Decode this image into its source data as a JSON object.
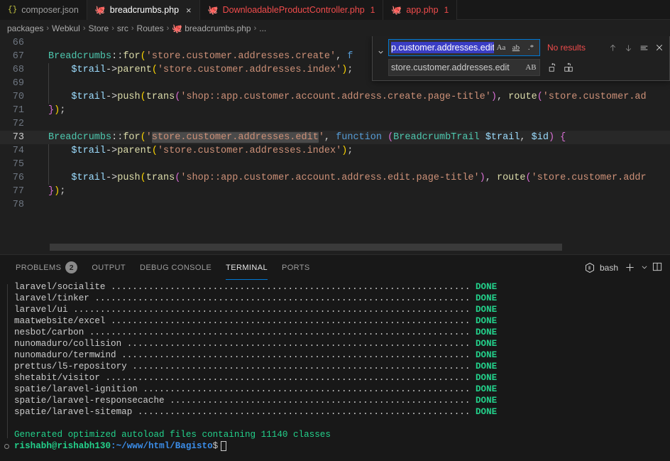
{
  "tabs": [
    {
      "label": "composer.json",
      "icon": "json-icon",
      "active": false,
      "dirty": false,
      "error_count": ""
    },
    {
      "label": "breadcrumbs.php",
      "icon": "php-icon",
      "active": true,
      "dirty": false,
      "error_count": "",
      "close": "×"
    },
    {
      "label": "DownloadableProductController.php",
      "icon": "php-icon",
      "active": false,
      "error_count": "1"
    },
    {
      "label": "app.php",
      "icon": "php-icon",
      "active": false,
      "error_count": "1"
    }
  ],
  "breadcrumb": {
    "items": [
      "packages",
      "Webkul",
      "Store",
      "src",
      "Routes",
      "breadcrumbs.php",
      "..."
    ],
    "separator": "›",
    "file_icon": "php-icon"
  },
  "editor": {
    "lines": [
      {
        "num": "66",
        "current": false,
        "indent_guide": false,
        "tokens": []
      },
      {
        "num": "67",
        "current": false,
        "indent_guide": false,
        "tokens": [
          {
            "t": "Breadcrumbs",
            "c": "t-class"
          },
          {
            "t": "::",
            "c": "t-punc"
          },
          {
            "t": "for",
            "c": "t-fn"
          },
          {
            "t": "(",
            "c": "t-paren"
          },
          {
            "t": "'store.customer.addresses.create'",
            "c": "t-str"
          },
          {
            "t": ",",
            "c": "t-punc"
          },
          {
            "t": " f",
            "c": "t-kw"
          }
        ]
      },
      {
        "num": "68",
        "current": false,
        "indent_guide": true,
        "tokens": [
          {
            "t": "    ",
            "c": "t-op"
          },
          {
            "t": "$trail",
            "c": "t-var"
          },
          {
            "t": "->",
            "c": "t-op"
          },
          {
            "t": "parent",
            "c": "t-fn"
          },
          {
            "t": "(",
            "c": "t-paren"
          },
          {
            "t": "'store.customer.addresses.index'",
            "c": "t-str"
          },
          {
            "t": ")",
            "c": "t-paren"
          },
          {
            "t": ";",
            "c": "t-punc"
          }
        ]
      },
      {
        "num": "69",
        "current": false,
        "indent_guide": true,
        "tokens": []
      },
      {
        "num": "70",
        "current": false,
        "indent_guide": true,
        "tokens": [
          {
            "t": "    ",
            "c": "t-op"
          },
          {
            "t": "$trail",
            "c": "t-var"
          },
          {
            "t": "->",
            "c": "t-op"
          },
          {
            "t": "push",
            "c": "t-fn"
          },
          {
            "t": "(",
            "c": "t-paren"
          },
          {
            "t": "trans",
            "c": "t-fn"
          },
          {
            "t": "(",
            "c": "t-paren2"
          },
          {
            "t": "'shop::app.customer.account.address.create.page-title'",
            "c": "t-str"
          },
          {
            "t": ")",
            "c": "t-paren2"
          },
          {
            "t": ",",
            "c": "t-punc"
          },
          {
            "t": " ",
            "c": "t-op"
          },
          {
            "t": "route",
            "c": "t-fn"
          },
          {
            "t": "(",
            "c": "t-paren2"
          },
          {
            "t": "'store.customer.ad",
            "c": "t-str"
          }
        ]
      },
      {
        "num": "71",
        "current": false,
        "indent_guide": false,
        "tokens": [
          {
            "t": "}",
            "c": "t-brace"
          },
          {
            "t": ")",
            "c": "t-paren"
          },
          {
            "t": ";",
            "c": "t-punc"
          }
        ]
      },
      {
        "num": "72",
        "current": false,
        "indent_guide": false,
        "tokens": []
      },
      {
        "num": "73",
        "current": true,
        "indent_guide": false,
        "tokens": [
          {
            "t": "Breadcrumbs",
            "c": "t-class"
          },
          {
            "t": "::",
            "c": "t-punc"
          },
          {
            "t": "for",
            "c": "t-fn"
          },
          {
            "t": "(",
            "c": "t-paren"
          },
          {
            "t": "'",
            "c": "t-str"
          },
          {
            "t": "store.customer.addresses.edit",
            "c": "t-str sel-hl"
          },
          {
            "t": "'",
            "c": "t-str"
          },
          {
            "t": ",",
            "c": "t-punc"
          },
          {
            "t": " ",
            "c": "t-op"
          },
          {
            "t": "function",
            "c": "t-kw"
          },
          {
            "t": " ",
            "c": "t-op"
          },
          {
            "t": "(",
            "c": "t-paren2"
          },
          {
            "t": "BreadcrumbTrail",
            "c": "t-class"
          },
          {
            "t": " ",
            "c": "t-op"
          },
          {
            "t": "$trail",
            "c": "t-var"
          },
          {
            "t": ",",
            "c": "t-punc"
          },
          {
            "t": " ",
            "c": "t-op"
          },
          {
            "t": "$id",
            "c": "t-var"
          },
          {
            "t": ")",
            "c": "t-paren2"
          },
          {
            "t": " ",
            "c": "t-op"
          },
          {
            "t": "{",
            "c": "t-brace"
          }
        ]
      },
      {
        "num": "74",
        "current": false,
        "indent_guide": true,
        "tokens": [
          {
            "t": "    ",
            "c": "t-op"
          },
          {
            "t": "$trail",
            "c": "t-var"
          },
          {
            "t": "->",
            "c": "t-op"
          },
          {
            "t": "parent",
            "c": "t-fn"
          },
          {
            "t": "(",
            "c": "t-paren"
          },
          {
            "t": "'store.customer.addresses.index'",
            "c": "t-str"
          },
          {
            "t": ")",
            "c": "t-paren"
          },
          {
            "t": ";",
            "c": "t-punc"
          }
        ]
      },
      {
        "num": "75",
        "current": false,
        "indent_guide": true,
        "tokens": []
      },
      {
        "num": "76",
        "current": false,
        "indent_guide": true,
        "tokens": [
          {
            "t": "    ",
            "c": "t-op"
          },
          {
            "t": "$trail",
            "c": "t-var"
          },
          {
            "t": "->",
            "c": "t-op"
          },
          {
            "t": "push",
            "c": "t-fn"
          },
          {
            "t": "(",
            "c": "t-paren"
          },
          {
            "t": "trans",
            "c": "t-fn"
          },
          {
            "t": "(",
            "c": "t-paren2"
          },
          {
            "t": "'shop::app.customer.account.address.edit.page-title'",
            "c": "t-str"
          },
          {
            "t": ")",
            "c": "t-paren2"
          },
          {
            "t": ",",
            "c": "t-punc"
          },
          {
            "t": " ",
            "c": "t-op"
          },
          {
            "t": "route",
            "c": "t-fn"
          },
          {
            "t": "(",
            "c": "t-paren2"
          },
          {
            "t": "'store.customer.addr",
            "c": "t-str"
          }
        ]
      },
      {
        "num": "77",
        "current": false,
        "indent_guide": false,
        "tokens": [
          {
            "t": "}",
            "c": "t-brace"
          },
          {
            "t": ")",
            "c": "t-paren"
          },
          {
            "t": ";",
            "c": "t-punc"
          }
        ]
      },
      {
        "num": "78",
        "current": false,
        "indent_guide": false,
        "tokens": []
      }
    ]
  },
  "find_widget": {
    "toggle_icon": "chevron-down-icon",
    "find_value": "p.customer.addresses.edit",
    "find_placeholder": "Find",
    "replace_value": "store.customer.addresses.edit",
    "replace_placeholder": "Replace",
    "match_case_label": "Aa",
    "match_whole_word_label": "ab",
    "use_regex_label": ".*",
    "preserve_case_label": "AB",
    "status": "No results",
    "status_color": "#f14c4c",
    "prev_icon": "arrow-up-icon",
    "next_icon": "arrow-down-icon",
    "selection_find_icon": "find-in-selection-icon",
    "close_icon": "close-icon",
    "replace_one_icon": "replace-icon",
    "replace_all_icon": "replace-all-icon"
  },
  "panel": {
    "tabs": [
      {
        "label": "PROBLEMS",
        "badge": "2",
        "active": false
      },
      {
        "label": "OUTPUT",
        "badge": "",
        "active": false
      },
      {
        "label": "DEBUG CONSOLE",
        "badge": "",
        "active": false
      },
      {
        "label": "TERMINAL",
        "badge": "",
        "active": true
      },
      {
        "label": "PORTS",
        "badge": "",
        "active": false
      }
    ],
    "active_tab_underline_color": "#0078d4",
    "shell_name": "bash",
    "shell_icon": "terminal-cube-icon",
    "new_terminal_icon": "plus-icon",
    "new_terminal_dropdown_icon": "chevron-down-icon",
    "split_terminal_icon": "split-editor-icon"
  },
  "terminal": {
    "packages": [
      {
        "name": "laravel/socialite",
        "status": "DONE"
      },
      {
        "name": "laravel/tinker",
        "status": "DONE"
      },
      {
        "name": "laravel/ui",
        "status": "DONE"
      },
      {
        "name": "maatwebsite/excel",
        "status": "DONE"
      },
      {
        "name": "nesbot/carbon",
        "status": "DONE"
      },
      {
        "name": "nunomaduro/collision",
        "status": "DONE"
      },
      {
        "name": "nunomaduro/termwind",
        "status": "DONE"
      },
      {
        "name": "prettus/l5-repository",
        "status": "DONE"
      },
      {
        "name": "shetabit/visitor",
        "status": "DONE"
      },
      {
        "name": "spatie/laravel-ignition",
        "status": "DONE"
      },
      {
        "name": "spatie/laravel-responsecache",
        "status": "DONE"
      },
      {
        "name": "spatie/laravel-sitemap",
        "status": "DONE"
      }
    ],
    "summary": "Generated optimized autoload files containing 11140 classes",
    "prompt": {
      "user_host": "rishabh@rishabh130",
      "path": ":~/www/html/Bagisto",
      "symbol": "$"
    }
  }
}
